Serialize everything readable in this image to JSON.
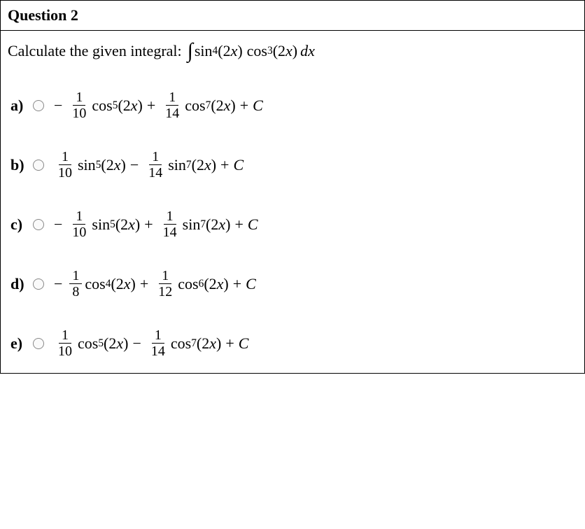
{
  "question": {
    "number": "Question 2",
    "prompt_text": "Calculate the given integral:",
    "integral": {
      "integrand_fn1": "sin",
      "integrand_pow1": "4",
      "integrand_arg1": "(2x)",
      "integrand_fn2": "cos",
      "integrand_pow2": "3",
      "integrand_arg2": "(2x)",
      "dx": "dx"
    }
  },
  "options": [
    {
      "label": "a)",
      "leading_sign": "−",
      "terms": [
        {
          "num": "1",
          "den": "10",
          "fn": "cos",
          "pow": "5",
          "arg": "(2x)"
        },
        {
          "op": "+",
          "num": "1",
          "den": "14",
          "fn": "cos",
          "pow": "7",
          "arg": "(2x)"
        }
      ],
      "tail_op": "+",
      "const": "C"
    },
    {
      "label": "b)",
      "leading_sign": "",
      "terms": [
        {
          "num": "1",
          "den": "10",
          "fn": "sin",
          "pow": "5",
          "arg": "(2x)"
        },
        {
          "op": "−",
          "num": "1",
          "den": "14",
          "fn": "sin",
          "pow": "7",
          "arg": "(2x)"
        }
      ],
      "tail_op": "+",
      "const": "C"
    },
    {
      "label": "c)",
      "leading_sign": "−",
      "terms": [
        {
          "num": "1",
          "den": "10",
          "fn": "sin",
          "pow": "5",
          "arg": "(2x)"
        },
        {
          "op": "+",
          "num": "1",
          "den": "14",
          "fn": "sin",
          "pow": "7",
          "arg": "(2x)"
        }
      ],
      "tail_op": "+",
      "const": "C"
    },
    {
      "label": "d)",
      "leading_sign": "−",
      "terms": [
        {
          "num": "1",
          "den": "8",
          "fn": "cos",
          "pow": "4",
          "arg": "(2x)"
        },
        {
          "op": "+",
          "num": "1",
          "den": "12",
          "fn": "cos",
          "pow": "6",
          "arg": "(2x)"
        }
      ],
      "tail_op": "+",
      "const": "C"
    },
    {
      "label": "e)",
      "leading_sign": "",
      "terms": [
        {
          "num": "1",
          "den": "10",
          "fn": "cos",
          "pow": "5",
          "arg": "(2x)"
        },
        {
          "op": "−",
          "num": "1",
          "den": "14",
          "fn": "cos",
          "pow": "7",
          "arg": "(2x)"
        }
      ],
      "tail_op": "+",
      "const": "C"
    }
  ]
}
